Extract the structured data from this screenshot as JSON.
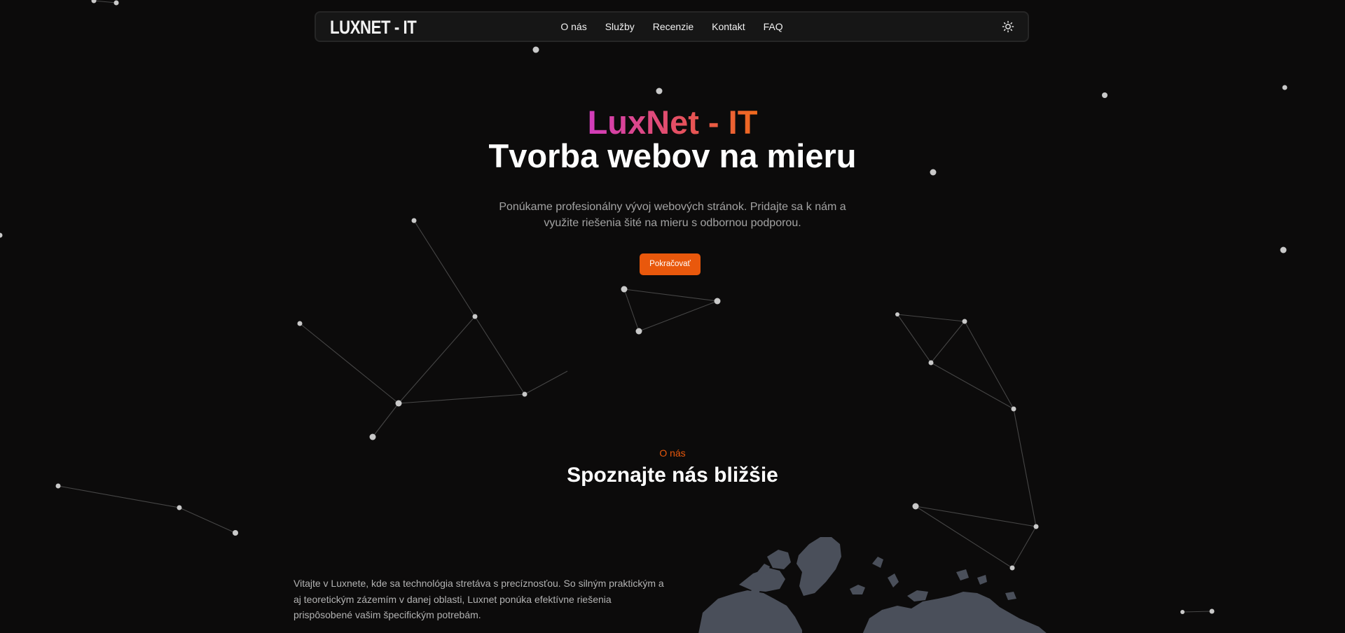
{
  "nav": {
    "logo": "LUXNET - IT",
    "links": [
      "O nás",
      "Služby",
      "Recenzie",
      "Kontakt",
      "FAQ"
    ],
    "theme_icon": "sun-icon"
  },
  "hero": {
    "brand": "LuxNet - IT",
    "title": "Tvorba webov na mieru",
    "subtitle": "Ponúkame profesionálny vývoj webových stránok. Pridajte sa k nám a využite riešenia šité na mieru s odbornou podporou.",
    "cta": "Pokračovať"
  },
  "about": {
    "kicker": "O nás",
    "title": "Spoznajte nás bližšie",
    "text": "Vitajte v Luxnete, kde sa technológia stretáva s precíznosťou. So silným praktickým a aj teoretickým zázemím v danej oblasti, Luxnet ponúka efektívne riešenia prispôsobené vašim špecifickým potrebám."
  },
  "colors": {
    "background": "#0c0b0b",
    "accent": "#e9580c",
    "gradient_start": "#d13cbd",
    "gradient_end": "#f06a1d",
    "map": "#4a4f5a"
  }
}
